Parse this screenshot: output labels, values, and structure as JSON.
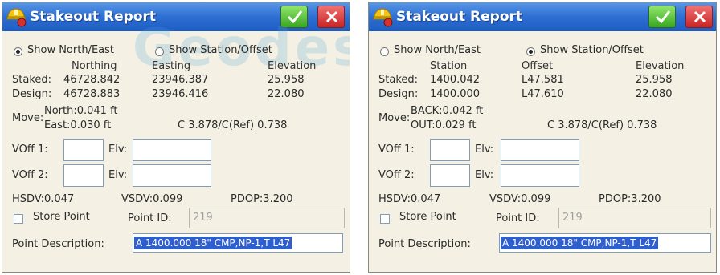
{
  "colors": {
    "titlebar": "#2d6fd4",
    "window_bg": "#f4f1e4",
    "ok_button": "#3aa620",
    "close_button": "#c82424",
    "selection": "#2f5fcf",
    "watermark": "#50a5d7"
  },
  "watermark": "Geodesical",
  "left": {
    "title": "Stakeout Report",
    "radio_north_east": "Show North/East",
    "radio_station_offset": "Show Station/Offset",
    "col1": "Northing",
    "col2": "Easting",
    "col3": "Elevation",
    "staked_label": "Staked:",
    "staked": [
      "46728.842",
      "23946.387",
      "25.958"
    ],
    "design_label": "Design:",
    "design": [
      "46728.883",
      "23946.416",
      "22.080"
    ],
    "move_label": "Move:",
    "move_line1": "North:0.041 ft",
    "move_line2": "East:0.030 ft",
    "c_ref": "C 3.878/C(Ref) 0.738",
    "voff1_label": "VOff 1:",
    "voff2_label": "VOff 2:",
    "elv_label": "Elv:",
    "hsdv": "HSDV:0.047",
    "vsdv": "VSDV:0.099",
    "pdop": "PDOP:3.200",
    "store_point": "Store Point",
    "point_id_label": "Point ID:",
    "point_id": "219",
    "point_description_label": "Point Description:",
    "point_description": "A 1400.000 18\" CMP,NP-1,T L47"
  },
  "right": {
    "title": "Stakeout Report",
    "radio_north_east": "Show North/East",
    "radio_station_offset": "Show Station/Offset",
    "col1": "Station",
    "col2": "Offset",
    "col3": "Elevation",
    "staked_label": "Staked:",
    "staked": [
      "1400.042",
      "L47.581",
      "25.958"
    ],
    "design_label": "Design:",
    "design": [
      "1400.000",
      "L47.610",
      "22.080"
    ],
    "move_label": "Move:",
    "move_line1": "BACK:0.042 ft",
    "move_line2": "OUT:0.029 ft",
    "c_ref": "C 3.878/C(Ref) 0.738",
    "voff1_label": "VOff 1:",
    "voff2_label": "VOff 2:",
    "elv_label": "Elv:",
    "hsdv": "HSDV:0.047",
    "vsdv": "VSDV:0.099",
    "pdop": "PDOP:3.200",
    "store_point": "Store Point",
    "point_id_label": "Point ID:",
    "point_id": "219",
    "point_description_label": "Point Description:",
    "point_description": "A 1400.000 18\" CMP,NP-1,T L47"
  }
}
